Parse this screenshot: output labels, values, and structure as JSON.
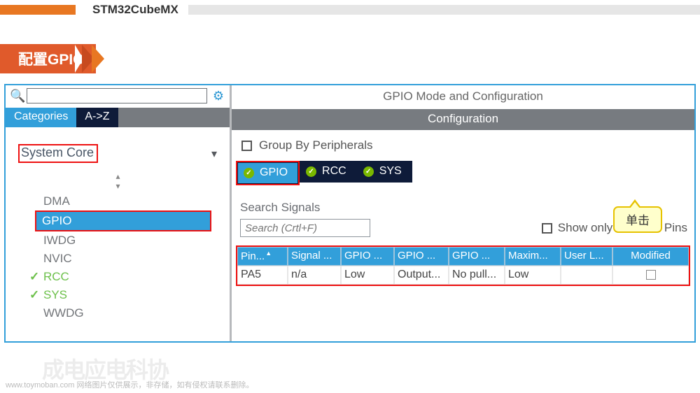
{
  "header": {
    "app_title": "STM32CubeMX"
  },
  "section": {
    "heading": "配置GPIO"
  },
  "left": {
    "search_value": "",
    "gear_icon": "gear",
    "tabs": {
      "categories": "Categories",
      "az": "A->Z"
    },
    "system_core": "System Core",
    "tree": [
      "DMA",
      "GPIO",
      "IWDG",
      "NVIC",
      "RCC",
      "SYS",
      "WWDG"
    ],
    "selected": "GPIO",
    "checked": [
      "RCC",
      "SYS"
    ]
  },
  "right": {
    "title": "GPIO Mode and Configuration",
    "conf_bar": "Configuration",
    "group_by": "Group By Peripherals",
    "periph_tabs": [
      "GPIO",
      "RCC",
      "SYS"
    ],
    "active_tab": "GPIO",
    "search_signals_label": "Search Signals",
    "search_signals_ph": "Search (Crtl+F)",
    "show_only_modified": "Show only Modified Pins",
    "callout": "单击",
    "columns": [
      "Pin...",
      "Signal ...",
      "GPIO ...",
      "GPIO ...",
      "GPIO ...",
      "Maxim...",
      "User L...",
      "Modified"
    ],
    "rows": [
      {
        "pin": "PA5",
        "signal": "n/a",
        "gpio1": "Low",
        "gpio2": "Output...",
        "gpio3": "No pull...",
        "max": "Low",
        "user": "",
        "modified": false
      }
    ]
  },
  "footer": {
    "wm_text": "成电应电科协",
    "note": "www.toymoban.com 网络图片仅供展示，非存储，如有侵权请联系删除。"
  }
}
